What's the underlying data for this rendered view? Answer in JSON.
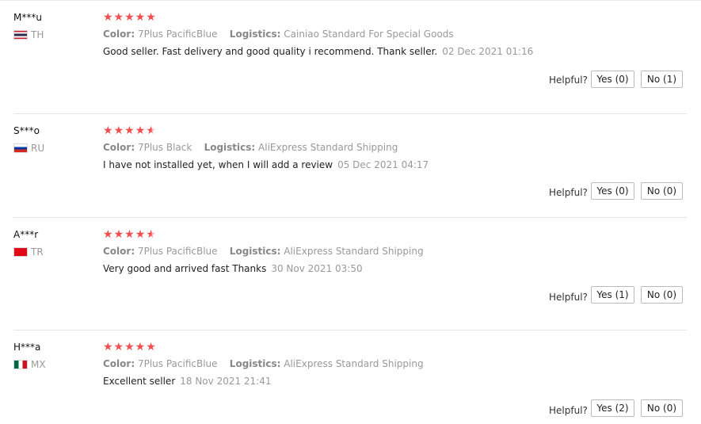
{
  "helpful_label": "Helpful?",
  "reviews": [
    {
      "user": "M***u",
      "country": "TH",
      "flag": [
        "#cc1f2f",
        "#ffffff",
        "#2d2a4a",
        "#ffffff",
        "#cc1f2f"
      ],
      "rating": 5,
      "stars": "★★★★★",
      "color_label": "Color:",
      "color_value": "7Plus PacificBlue",
      "logistics_label": "Logistics:",
      "logistics_value": "Cainiao Standard For Special Goods",
      "text": "Good seller. Fast delivery and good quality i recommend. Thank seller.",
      "date": "02 Dec 2021 01:16",
      "yes": "Yes (0)",
      "no": "No (1)"
    },
    {
      "user": "S***o",
      "country": "RU",
      "flag": [
        "#ffffff",
        "#0039a6",
        "#d52b1e"
      ],
      "rating": 4.5,
      "stars": "★★★★★",
      "color_label": "Color:",
      "color_value": "7Plus Black",
      "logistics_label": "Logistics:",
      "logistics_value": "AliExpress Standard Shipping",
      "text": "I have not installed yet, when I will add a review",
      "date": "05 Dec 2021 04:17",
      "yes": "Yes (0)",
      "no": "No (0)"
    },
    {
      "user": "A***r",
      "country": "TR",
      "flag": [
        "#e30a17"
      ],
      "rating": 4.5,
      "stars": "★★★★★",
      "color_label": "Color:",
      "color_value": "7Plus PacificBlue",
      "logistics_label": "Logistics:",
      "logistics_value": "AliExpress Standard Shipping",
      "text": "Very good and arrived fast Thanks",
      "date": "30 Nov 2021 03:50",
      "yes": "Yes (1)",
      "no": "No (0)"
    },
    {
      "user": "H***a",
      "country": "MX",
      "flag": [
        "#006847",
        "#ffffff",
        "#ce1126"
      ],
      "rating": 5,
      "stars": "★★★★★",
      "color_label": "Color:",
      "color_value": "7Plus PacificBlue",
      "logistics_label": "Logistics:",
      "logistics_value": "AliExpress Standard Shipping",
      "text": "Excellent seller",
      "date": "18 Nov 2021 21:41",
      "yes": "Yes (2)",
      "no": "No (0)"
    }
  ]
}
